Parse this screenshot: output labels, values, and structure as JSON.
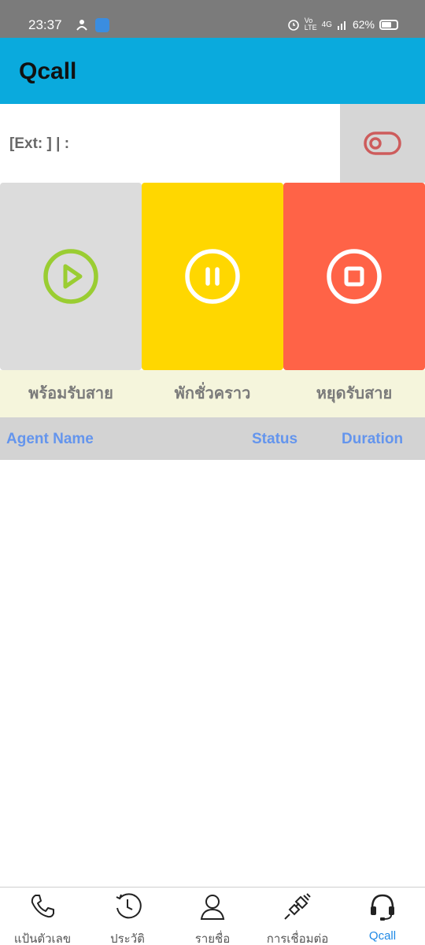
{
  "status_bar": {
    "time": "23:37",
    "battery": "62%",
    "network": "4G"
  },
  "app": {
    "title": "Qcall"
  },
  "extension": {
    "text": "[Ext: ] | :"
  },
  "actions": {
    "ready_label": "พร้อมรับสาย",
    "pause_label": "พักชั่วคราว",
    "stop_label": "หยุดรับสาย"
  },
  "table": {
    "headers": {
      "agent_name": "Agent Name",
      "status": "Status",
      "duration": "Duration"
    },
    "rows": []
  },
  "bottom_nav": {
    "items": [
      {
        "label": "แป้นตัวเลข",
        "icon": "phone-icon"
      },
      {
        "label": "ประวัติ",
        "icon": "history-clock-icon"
      },
      {
        "label": "รายชื่อ",
        "icon": "contact-person-icon"
      },
      {
        "label": "การเชื่อมต่อ",
        "icon": "plug-connection-icon"
      },
      {
        "label": "Qcall",
        "icon": "headset-icon"
      }
    ],
    "active_index": 4
  },
  "colors": {
    "app_bar": "#0aaadd",
    "ready_bg": "#dcdcdc",
    "pause_bg": "#ffd700",
    "stop_bg": "#ff6347",
    "ready_icon": "#9acd32",
    "toggle_icon": "#cd5c5c",
    "header_text": "#6495ed",
    "active_nav": "#1e88e5"
  }
}
